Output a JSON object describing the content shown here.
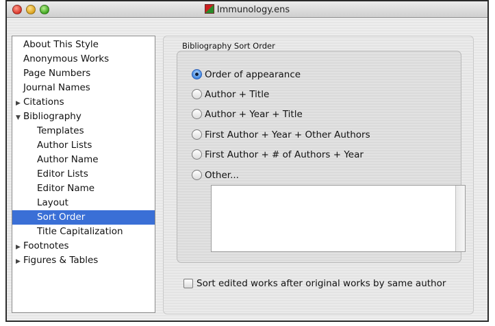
{
  "window": {
    "title": "Immunology.ens"
  },
  "sidebar": {
    "items": [
      {
        "label": "About This Style",
        "level": 0
      },
      {
        "label": "Anonymous Works",
        "level": 0
      },
      {
        "label": "Page Numbers",
        "level": 0
      },
      {
        "label": "Journal Names",
        "level": 0
      },
      {
        "label": "Citations",
        "level": 0,
        "disclosure": "collapsed"
      },
      {
        "label": "Bibliography",
        "level": 0,
        "disclosure": "expanded"
      },
      {
        "label": "Templates",
        "level": 1
      },
      {
        "label": "Author Lists",
        "level": 1
      },
      {
        "label": "Author Name",
        "level": 1
      },
      {
        "label": "Editor Lists",
        "level": 1
      },
      {
        "label": "Editor Name",
        "level": 1
      },
      {
        "label": "Layout",
        "level": 1
      },
      {
        "label": "Sort Order",
        "level": 1,
        "selected": true
      },
      {
        "label": "Title Capitalization",
        "level": 1
      },
      {
        "label": "Footnotes",
        "level": 0,
        "disclosure": "collapsed"
      },
      {
        "label": "Figures & Tables",
        "level": 0,
        "disclosure": "collapsed"
      }
    ],
    "selected_color": "#3a6fd6"
  },
  "sort_order": {
    "group_label": "Bibliography Sort Order",
    "options": [
      {
        "label": "Order of appearance",
        "checked": true
      },
      {
        "label": "Author + Title",
        "checked": false
      },
      {
        "label": "Author + Year + Title",
        "checked": false
      },
      {
        "label": "First Author + Year + Other Authors",
        "checked": false
      },
      {
        "label": "First Author + # of Authors + Year",
        "checked": false
      },
      {
        "label": "Other...",
        "checked": false
      }
    ],
    "other_value": ""
  },
  "options": {
    "sort_edited_label": "Sort edited works after original works by same author",
    "sort_edited_checked": false
  }
}
